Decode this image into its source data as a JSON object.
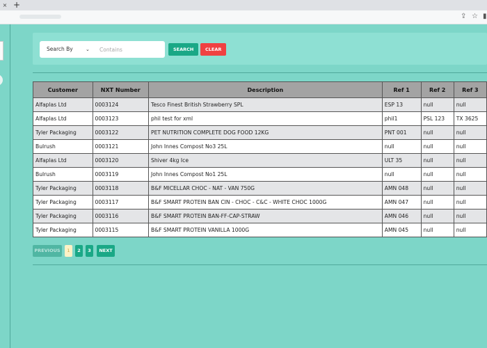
{
  "browser": {
    "tab_close_icon": "×",
    "new_tab_icon": "+"
  },
  "search": {
    "search_by_label": "Search By",
    "input_placeholder": "Contains",
    "search_button": "SEARCH",
    "clear_button": "CLEAR"
  },
  "table": {
    "headers": [
      "Customer",
      "NXT Number",
      "Description",
      "Ref 1",
      "Ref 2",
      "Ref 3"
    ],
    "rows": [
      [
        "Alfaplas Ltd",
        "0003124",
        "Tesco Finest British Strawberry SPL",
        "ESP 13",
        "null",
        "null"
      ],
      [
        "Alfaplas Ltd",
        "0003123",
        "phil test for xml",
        "phil1",
        "PSL 123",
        "TX 3625"
      ],
      [
        "Tyler Packaging",
        "0003122",
        "PET NUTRITION COMPLETE DOG FOOD 12KG",
        "PNT 001",
        "null",
        "null"
      ],
      [
        "Bulrush",
        "0003121",
        "John Innes Compost No3 25L",
        "null",
        "null",
        "null"
      ],
      [
        "Alfaplas Ltd",
        "0003120",
        "Shiver 4kg Ice",
        "ULT 35",
        "null",
        "null"
      ],
      [
        "Bulrush",
        "0003119",
        "John Innes Compost No1 25L",
        "null",
        "null",
        "null"
      ],
      [
        "Tyler Packaging",
        "0003118",
        "B&F MICELLAR CHOC - NAT - VAN 750G",
        "AMN 048",
        "null",
        "null"
      ],
      [
        "Tyler Packaging",
        "0003117",
        "B&F SMART PROTEIN BAN CIN - CHOC - C&C - WHITE CHOC 1000G",
        "AMN 047",
        "null",
        "null"
      ],
      [
        "Tyler Packaging",
        "0003116",
        "B&F SMART PROTEIN BAN-FF-CAP-STRAW",
        "AMN 046",
        "null",
        "null"
      ],
      [
        "Tyler Packaging",
        "0003115",
        "B&F SMART PROTEIN VANILLA 1000G",
        "AMN 045",
        "null",
        "null"
      ]
    ]
  },
  "pagination": {
    "previous": "PREVIOUS",
    "pages": [
      "1",
      "2",
      "3"
    ],
    "current_page": "1",
    "next": "NEXT"
  },
  "colors": {
    "page_background": "#7dd6c8",
    "panel": "#8ee0d3",
    "primary_button": "#1aa886",
    "danger_button": "#f04141",
    "table_header": "#a3a3a3"
  }
}
